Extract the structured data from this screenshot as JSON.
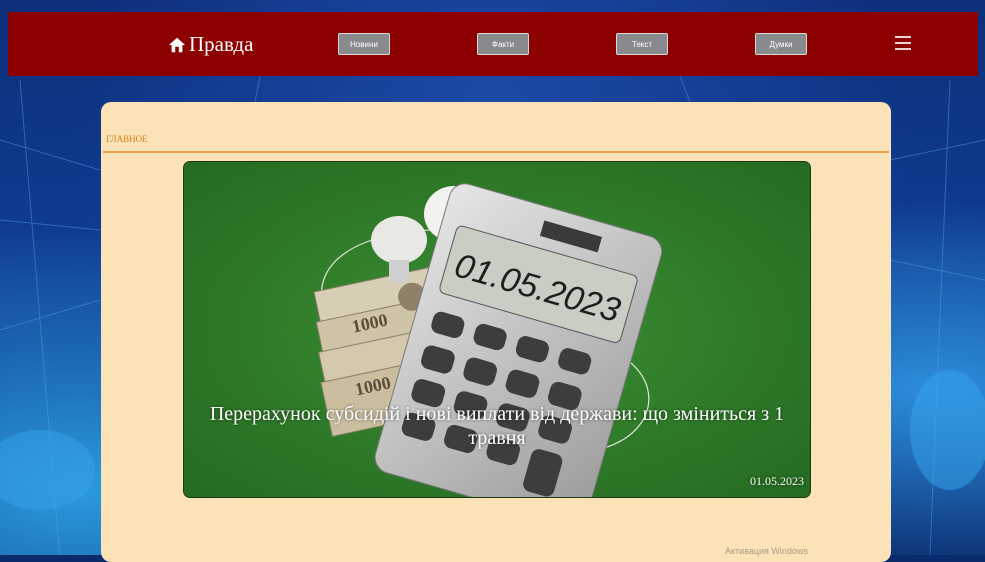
{
  "header": {
    "brand": "Правда",
    "nav": [
      "Новини",
      "Факти",
      "Текст",
      "Думки"
    ],
    "colors": {
      "bar": "#8c0000",
      "button": "#888a8e"
    }
  },
  "section": {
    "title": "ГЛАВНОЕ"
  },
  "feature": {
    "headline": "Перерахунок субсидій і нові виплати від держави: що зміниться з 1 травня",
    "date": "01.05.2023",
    "calculator_display": "01.05.2023"
  },
  "watermark": {
    "text": "Активация Windows"
  }
}
